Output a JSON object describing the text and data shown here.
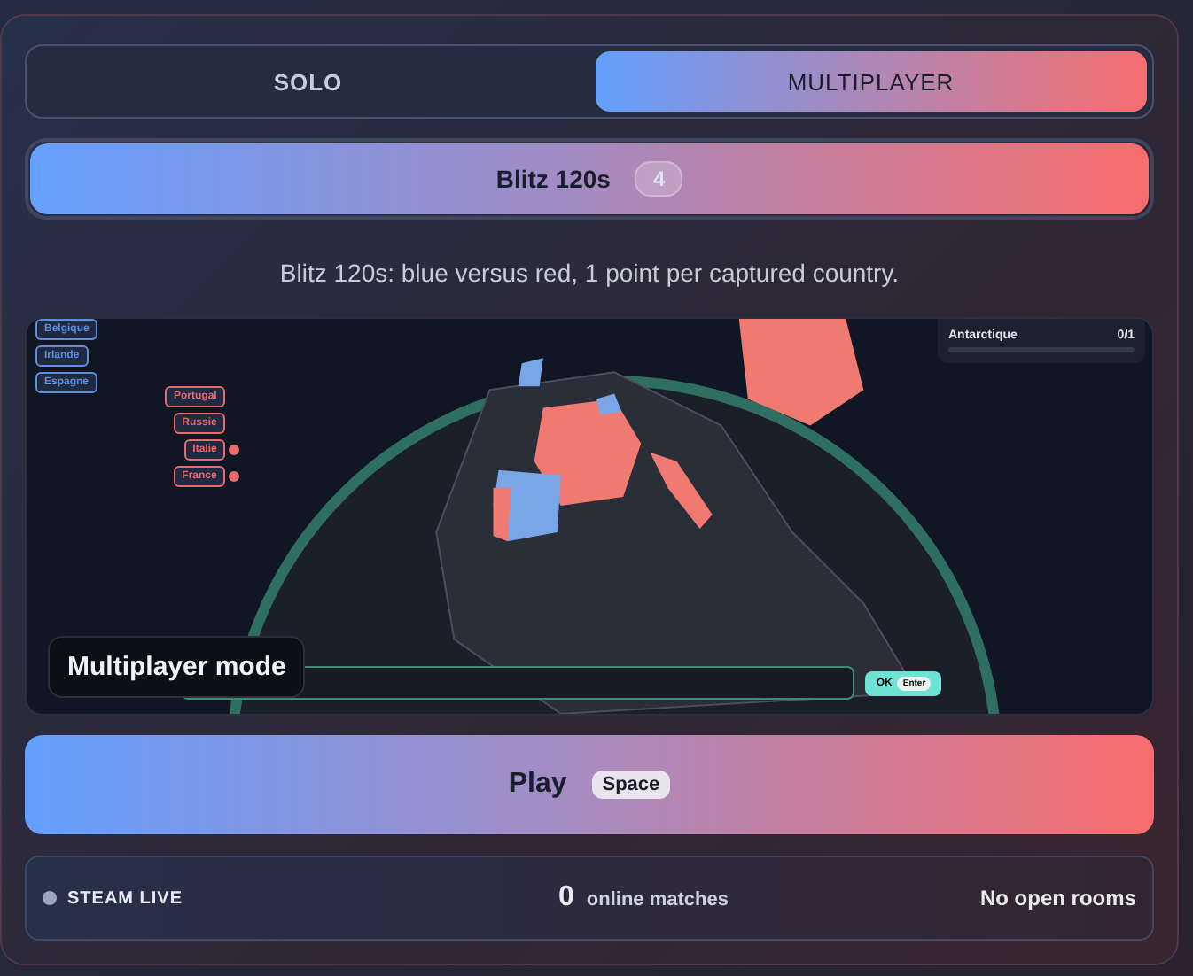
{
  "tabs": [
    {
      "label": "SOLO",
      "selected": false
    },
    {
      "label": "MULTIPLAYER",
      "selected": true
    }
  ],
  "mode": {
    "label": "Blitz 120s",
    "count": "4"
  },
  "description": "Blitz 120s: blue versus red, 1 point per captured country.",
  "map": {
    "tags": [
      {
        "label": "Belgique",
        "color": "#5b8fe0"
      },
      {
        "label": "Irlande",
        "color": "#5b8fe0"
      },
      {
        "label": "Espagne",
        "color": "#5b8fe0"
      },
      {
        "label": "Portugal",
        "color": "#e86a6a",
        "dot": false
      },
      {
        "label": "Russie",
        "color": "#e86a6a",
        "dot": false
      },
      {
        "label": "Italie",
        "color": "#e86a6a",
        "dot": true
      },
      {
        "label": "France",
        "color": "#e86a6a",
        "dot": true
      }
    ],
    "progress": [
      {
        "name": "Antarctique",
        "reading": "0/1",
        "level": 0
      }
    ],
    "overlay": "Multiplayer mode",
    "ok_button": {
      "label": "OK",
      "key": "Enter"
    }
  },
  "play": {
    "label": "Play",
    "key": "Space"
  },
  "status": {
    "indicator": "STEAM LIVE",
    "live": false,
    "count": "0",
    "count_label": "online matches",
    "rooms": "No open rooms"
  }
}
